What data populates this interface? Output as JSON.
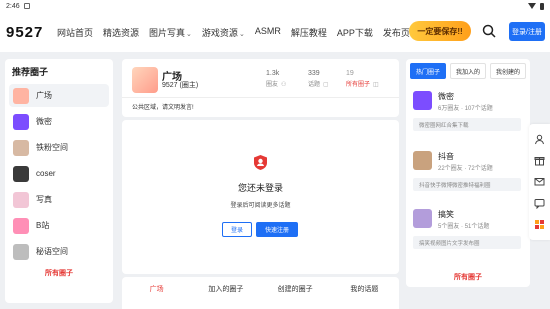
{
  "status": {
    "time": "2:46"
  },
  "header": {
    "logo": "9527",
    "nav": [
      {
        "label": "网站首页",
        "dropdown": false
      },
      {
        "label": "精选资源",
        "dropdown": false
      },
      {
        "label": "图片写真",
        "dropdown": true
      },
      {
        "label": "游戏资源",
        "dropdown": true
      },
      {
        "label": "ASMR",
        "dropdown": false
      },
      {
        "label": "解压教程",
        "dropdown": false
      },
      {
        "label": "APP下载",
        "dropdown": false
      },
      {
        "label": "发布页",
        "dropdown": false
      }
    ],
    "signin_label": "一定要保存!!",
    "login_label": "登录/注册"
  },
  "left": {
    "title": "推荐圈子",
    "items": [
      {
        "label": "广场",
        "color": "#ffb4a2"
      },
      {
        "label": "微密",
        "color": "#7c4dff"
      },
      {
        "label": "铁粉空间",
        "color": "#d7b9a3"
      },
      {
        "label": "coser",
        "color": "#3a3a3a"
      },
      {
        "label": "写真",
        "color": "#f2c6d6"
      },
      {
        "label": "B站",
        "color": "#ff8fb6"
      },
      {
        "label": "秘语空间",
        "color": "#bdbdbd"
      }
    ],
    "all_label": "所有圈子"
  },
  "circle": {
    "name": "广场",
    "sub": "9527 (圈主)",
    "stats": [
      {
        "num": "1.3k",
        "label": "圈友"
      },
      {
        "num": "339",
        "label": "话题"
      },
      {
        "num": "19",
        "label": "所有圈子"
      }
    ],
    "welcome": "公共区域，请文明发言!"
  },
  "main": {
    "title": "您还未登录",
    "sub": "登录后可阅读更多话题",
    "login_label": "登录",
    "register_label": "快速注册"
  },
  "bottom_tabs": [
    "广场",
    "加入的圈子",
    "创建的圈子",
    "我的话题"
  ],
  "right": {
    "tabs": [
      "热门圈子",
      "我加入的",
      "我创建的"
    ],
    "cards": [
      {
        "name": "微密",
        "members": "6万圈友",
        "topics": "107个话题",
        "desc": "微密圈网红合集下载",
        "color": "#7c4dff"
      },
      {
        "name": "抖音",
        "members": "22个圈友",
        "topics": "72个话题",
        "desc": "抖音快手微博微密推特福利圈",
        "color": "#c9a27e"
      },
      {
        "name": "搞笑",
        "members": "5个圈友",
        "topics": "51个话题",
        "desc": "搞笑视频图片文字发布圈",
        "color": "#b39ddb"
      }
    ],
    "all_label": "所有圈子"
  }
}
